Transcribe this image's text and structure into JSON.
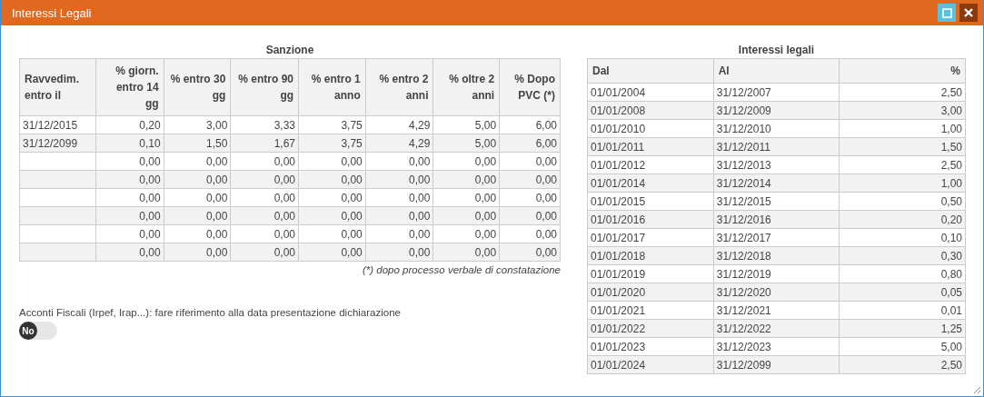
{
  "window": {
    "title": "Interessi Legali"
  },
  "sanzione": {
    "title": "Sanzione",
    "columns": [
      "Ravvedim. entro il",
      "% giorn. entro 14 gg",
      "% entro 30 gg",
      "% entro 90 gg",
      "% entro 1 anno",
      "% entro 2 anni",
      "% oltre 2 anni",
      "% Dopo PVC (*)"
    ],
    "rows": [
      [
        "31/12/2015",
        "0,20",
        "3,00",
        "3,33",
        "3,75",
        "4,29",
        "5,00",
        "6,00"
      ],
      [
        "31/12/2099",
        "0,10",
        "1,50",
        "1,67",
        "3,75",
        "4,29",
        "5,00",
        "6,00"
      ],
      [
        "",
        "0,00",
        "0,00",
        "0,00",
        "0,00",
        "0,00",
        "0,00",
        "0,00"
      ],
      [
        "",
        "0,00",
        "0,00",
        "0,00",
        "0,00",
        "0,00",
        "0,00",
        "0,00"
      ],
      [
        "",
        "0,00",
        "0,00",
        "0,00",
        "0,00",
        "0,00",
        "0,00",
        "0,00"
      ],
      [
        "",
        "0,00",
        "0,00",
        "0,00",
        "0,00",
        "0,00",
        "0,00",
        "0,00"
      ],
      [
        "",
        "0,00",
        "0,00",
        "0,00",
        "0,00",
        "0,00",
        "0,00",
        "0,00"
      ],
      [
        "",
        "0,00",
        "0,00",
        "0,00",
        "0,00",
        "0,00",
        "0,00",
        "0,00"
      ]
    ],
    "footnote": "(*) dopo processo verbale di constatazione"
  },
  "acconti": {
    "label": "Acconti Fiscali (Irpef, Irap...): fare riferimento alla data presentazione dichiarazione",
    "on": false,
    "text": "No"
  },
  "interessi": {
    "title": "Interessi legali",
    "columns": [
      "Dal",
      "Al",
      "%"
    ],
    "rows": [
      [
        "01/01/2004",
        "31/12/2007",
        "2,50"
      ],
      [
        "01/01/2008",
        "31/12/2009",
        "3,00"
      ],
      [
        "01/01/2010",
        "31/12/2010",
        "1,00"
      ],
      [
        "01/01/2011",
        "31/12/2011",
        "1,50"
      ],
      [
        "01/01/2012",
        "31/12/2013",
        "2,50"
      ],
      [
        "01/01/2014",
        "31/12/2014",
        "1,00"
      ],
      [
        "01/01/2015",
        "31/12/2015",
        "0,50"
      ],
      [
        "01/01/2016",
        "31/12/2016",
        "0,20"
      ],
      [
        "01/01/2017",
        "31/12/2017",
        "0,10"
      ],
      [
        "01/01/2018",
        "31/12/2018",
        "0,30"
      ],
      [
        "01/01/2019",
        "31/12/2019",
        "0,80"
      ],
      [
        "01/01/2020",
        "31/12/2020",
        "0,05"
      ],
      [
        "01/01/2021",
        "31/12/2021",
        "0,01"
      ],
      [
        "01/01/2022",
        "31/12/2022",
        "1,25"
      ],
      [
        "01/01/2023",
        "31/12/2023",
        "5,00"
      ],
      [
        "01/01/2024",
        "31/12/2099",
        "2,50"
      ]
    ]
  }
}
